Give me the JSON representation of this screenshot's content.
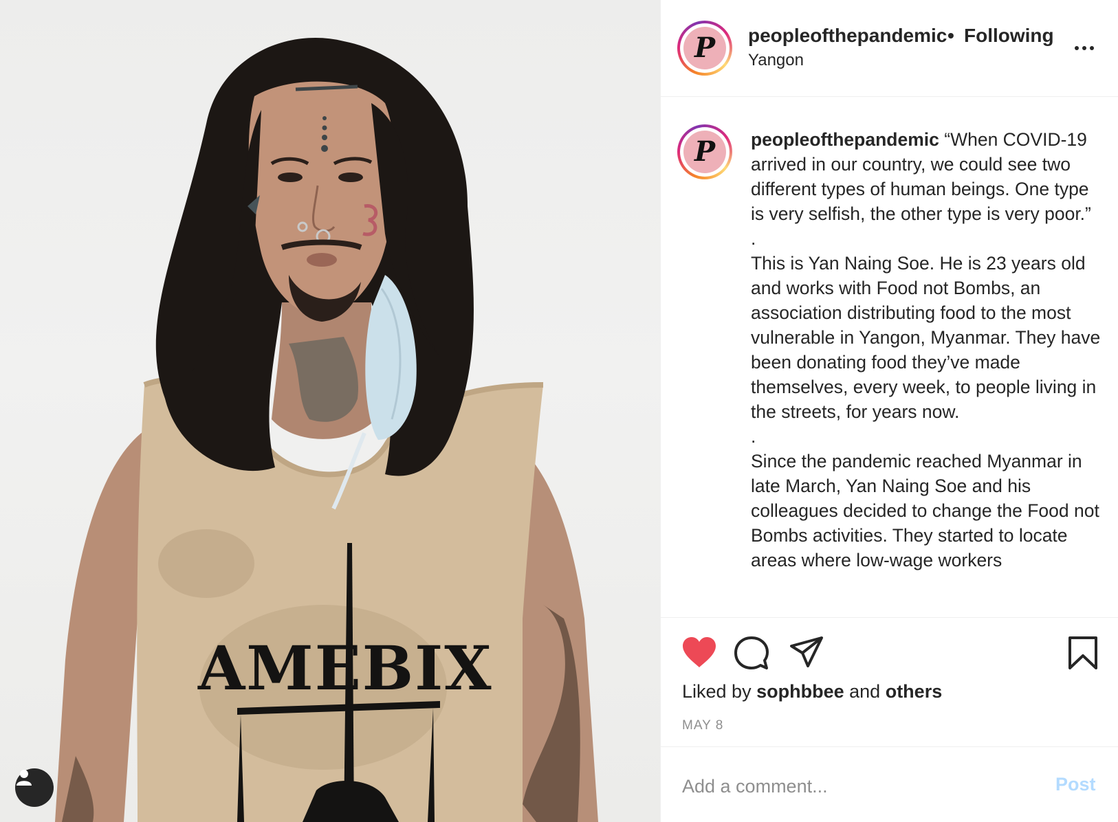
{
  "header": {
    "username": "peopleofthepandemic",
    "separator": "•",
    "follow_status": "Following",
    "location": "Yangon",
    "avatar_letter": "P",
    "more_icon": "more-options-icon"
  },
  "post": {
    "username": "peopleofthepandemic",
    "caption_paragraphs": [
      "“When COVID-19 arrived in our country, we could see two different types of human beings. One type is very selfish, the other type is very poor.”",
      ".",
      "This is Yan Naing Soe. He is 23 years old and works with Food not Bombs, an association distributing food to the most vulnerable in Yangon, Myanmar. They have been donating food they’ve made themselves, every week, to people living in the streets, for years now.",
      ".",
      "Since the pandemic reached Myanmar in late March, Yan Naing Soe and his colleagues decided to change the Food not Bombs activities. They started to locate areas where low-wage workers"
    ],
    "liked_prefix": "Liked by",
    "liked_user": "sophbbee",
    "liked_and": "and",
    "liked_others": "others",
    "date": "MAY 8"
  },
  "photo": {
    "shirt_text": "AMEBIX"
  },
  "actions": {
    "icons": [
      "heart-icon",
      "comment-icon",
      "share-icon",
      "bookmark-icon"
    ],
    "like_color": "#ed4956"
  },
  "comment": {
    "placeholder": "Add a comment...",
    "post_label": "Post",
    "post_color": "#b3dbff"
  }
}
